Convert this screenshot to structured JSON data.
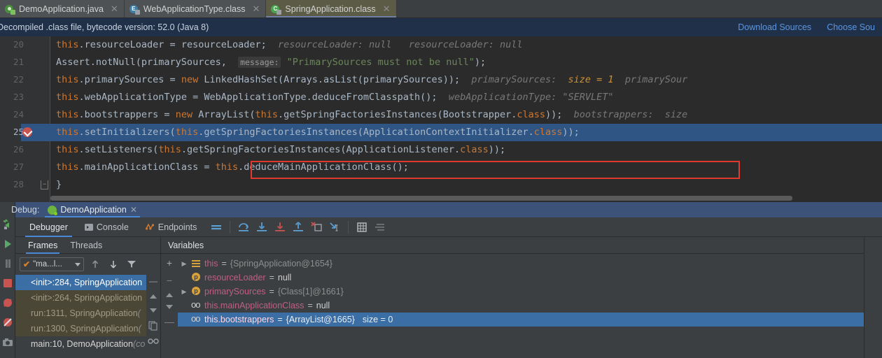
{
  "editor_tabs": [
    {
      "label": "DemoApplication.java",
      "icon": "java-file-icon",
      "active": false
    },
    {
      "label": "WebApplicationType.class",
      "icon": "enum-class-icon",
      "active": false
    },
    {
      "label": "SpringApplication.class",
      "icon": "class-file-icon",
      "active": true
    }
  ],
  "notice": {
    "message": "Decompiled .class file, bytecode version: 52.0 (Java 8)",
    "links": [
      {
        "label": "Download Sources"
      },
      {
        "label": "Choose Sou"
      }
    ]
  },
  "code": {
    "lines": [
      {
        "num": "20",
        "breakpoint": false,
        "highlighted": false,
        "fold": false,
        "tokens": [
          {
            "t": "this",
            "c": "k"
          },
          {
            "t": ".resourceLoader = resourceLoader;",
            "c": "def"
          },
          {
            "t": "  resourceLoader: null   resourceLoader: null",
            "c": "hint"
          }
        ]
      },
      {
        "num": "21",
        "breakpoint": false,
        "highlighted": false,
        "fold": false,
        "tokens": [
          {
            "t": "Assert.notNull(primarySources,  ",
            "c": "def"
          },
          {
            "t": "message:",
            "c": "pbox"
          },
          {
            "t": " ",
            "c": "def"
          },
          {
            "t": "\"PrimarySources must not be null\"",
            "c": "s"
          },
          {
            "t": ");",
            "c": "def"
          }
        ]
      },
      {
        "num": "22",
        "breakpoint": false,
        "highlighted": false,
        "fold": false,
        "tokens": [
          {
            "t": "this",
            "c": "k"
          },
          {
            "t": ".primarySources = ",
            "c": "def"
          },
          {
            "t": "new",
            "c": "k"
          },
          {
            "t": " LinkedHashSet(Arrays.asList(primarySources));",
            "c": "def"
          },
          {
            "t": "  primarySources:  ",
            "c": "hint"
          },
          {
            "t": "size = 1",
            "c": "hintnum"
          },
          {
            "t": "  primarySour",
            "c": "hint"
          }
        ]
      },
      {
        "num": "23",
        "breakpoint": false,
        "highlighted": false,
        "fold": false,
        "tokens": [
          {
            "t": "this",
            "c": "k"
          },
          {
            "t": ".webApplicationType = WebApplicationType.deduceFromClasspath();",
            "c": "def"
          },
          {
            "t": "  webApplicationType: \"SERVLET\"",
            "c": "hint"
          }
        ]
      },
      {
        "num": "24",
        "breakpoint": false,
        "highlighted": false,
        "fold": false,
        "tokens": [
          {
            "t": "this",
            "c": "k"
          },
          {
            "t": ".bootstrappers = ",
            "c": "def"
          },
          {
            "t": "new",
            "c": "k"
          },
          {
            "t": " ArrayList(",
            "c": "def"
          },
          {
            "t": "this",
            "c": "k"
          },
          {
            "t": ".getSpringFactoriesInstances(Bootstrapper.",
            "c": "def"
          },
          {
            "t": "class",
            "c": "k"
          },
          {
            "t": "));",
            "c": "def"
          },
          {
            "t": "  bootstrappers:  size",
            "c": "hint"
          }
        ]
      },
      {
        "num": "25",
        "breakpoint": true,
        "highlighted": true,
        "fold": false,
        "tokens": [
          {
            "t": "this",
            "c": "k"
          },
          {
            "t": ".setInitializers(",
            "c": "def"
          },
          {
            "t": "this",
            "c": "k"
          },
          {
            "t": ".getSpringFactoriesInstances(ApplicationContextInitializer.",
            "c": "def"
          },
          {
            "t": "class",
            "c": "k"
          },
          {
            "t": "));",
            "c": "def"
          }
        ]
      },
      {
        "num": "26",
        "breakpoint": false,
        "highlighted": false,
        "fold": false,
        "tokens": [
          {
            "t": "this",
            "c": "k"
          },
          {
            "t": ".setListeners(",
            "c": "def"
          },
          {
            "t": "this",
            "c": "k"
          },
          {
            "t": ".getSpringFactoriesInstances(ApplicationListener.",
            "c": "def"
          },
          {
            "t": "class",
            "c": "k"
          },
          {
            "t": "));",
            "c": "def"
          }
        ]
      },
      {
        "num": "27",
        "breakpoint": false,
        "highlighted": false,
        "fold": false,
        "tokens": [
          {
            "t": "this",
            "c": "k"
          },
          {
            "t": ".mainApplicationClass = ",
            "c": "def"
          },
          {
            "t": "this",
            "c": "k"
          },
          {
            "t": ".deduceMainApplicationClass();",
            "c": "def"
          }
        ]
      },
      {
        "num": "28",
        "breakpoint": false,
        "highlighted": false,
        "fold": true,
        "tokens": [
          {
            "t": "}",
            "c": "def"
          }
        ]
      }
    ]
  },
  "debug": {
    "header_label": "Debug:",
    "session_tab": "DemoApplication",
    "subtabs": [
      {
        "label": "Debugger",
        "selected": true
      },
      {
        "label": "Console",
        "selected": false
      },
      {
        "label": "Endpoints",
        "selected": false
      }
    ],
    "toolbar_icons": [
      "layout-settings-icon",
      "step-over-icon",
      "step-into-icon",
      "force-step-into-icon",
      "step-out-icon",
      "drop-frame-icon",
      "run-to-cursor-icon",
      "evaluate-expression-icon",
      "settings-list-icon"
    ],
    "frames": {
      "tabs": [
        {
          "label": "Frames",
          "selected": true
        },
        {
          "label": "Threads",
          "selected": false
        }
      ],
      "thread_selector": "\"ma...l...",
      "controls": [
        "up-arrow-icon",
        "down-arrow-icon",
        "filter-icon"
      ],
      "rows": [
        {
          "text": "<init>:284, SpringApplication",
          "suffix": "",
          "style": "sel"
        },
        {
          "text": "<init>:264, SpringApplication",
          "suffix": "",
          "style": "lib"
        },
        {
          "text": "run:1311, SpringApplication",
          "suffix": "(",
          "style": "lib"
        },
        {
          "text": "run:1300, SpringApplication",
          "suffix": "(",
          "style": "lib"
        },
        {
          "text": "main:10, DemoApplication",
          "suffix": "(co",
          "style": "app"
        }
      ]
    },
    "variables": {
      "title": "Variables",
      "tools": [
        "add-watch-icon",
        "remove-watch-icon",
        "move-up-icon",
        "move-down-icon"
      ],
      "rows": [
        {
          "expandable": true,
          "icon": "field-icon",
          "selected": false,
          "name": "this",
          "eq": " = ",
          "ref": "{SpringApplication@1654}",
          "value": "",
          "size": ""
        },
        {
          "expandable": false,
          "icon": "param-icon",
          "selected": false,
          "name": "resourceLoader",
          "eq": " = ",
          "ref": "",
          "value": "null",
          "size": ""
        },
        {
          "expandable": true,
          "icon": "param-icon",
          "selected": false,
          "name": "primarySources",
          "eq": " = ",
          "ref": "{Class[1]@1661}",
          "value": "",
          "size": ""
        },
        {
          "expandable": false,
          "icon": "watch-icon",
          "selected": false,
          "name": "this.mainApplicationClass",
          "eq": " = ",
          "ref": "",
          "value": "null",
          "size": ""
        },
        {
          "expandable": false,
          "icon": "watch-icon",
          "selected": true,
          "name": "this.bootstrappers",
          "eq": " = ",
          "ref": "{ArrayList@1665}",
          "value": "",
          "size": "size = 0"
        }
      ]
    },
    "left_strip_icons": [
      "rerun-icon",
      "resume-program-icon",
      "pause-program-icon",
      "stop-icon",
      "mute-breakpoints-icon",
      "view-breakpoints-icon",
      "settings-camera-icon"
    ]
  },
  "colors": {
    "accent_blue": "#4a88d6",
    "selection_blue": "#3a6ea5",
    "highlight_red": "#e03a2f",
    "keyword_orange": "#cc7832",
    "string_green": "#6a8759",
    "notice_bg": "#1f3048",
    "link_blue": "#5c96e0"
  }
}
